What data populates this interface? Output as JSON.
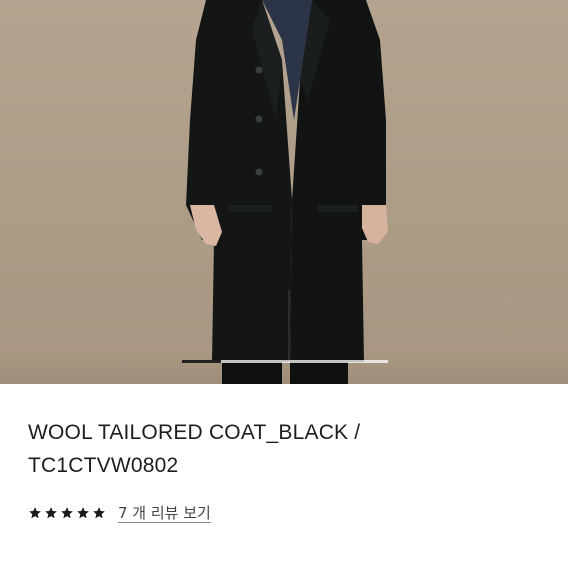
{
  "product": {
    "title_line1": "WOOL TAILORED COAT_BLACK /",
    "title_line2": "TC1CTVW0802",
    "image_alt": "model wearing black wool tailored coat",
    "gallery_progress": 0.19
  },
  "rating": {
    "stars": 5,
    "review_link": "7 개 리뷰 보기"
  },
  "colors": {
    "background": "#b0a08a",
    "coat": "#141616",
    "text": "#1e1e1e"
  },
  "icons": [
    "star-icon"
  ]
}
